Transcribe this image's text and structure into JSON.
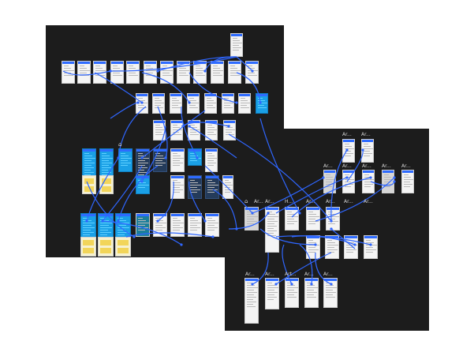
{
  "canvas": {
    "background": "#ffffff",
    "board_color": "#1c1c1c",
    "wire_color": "#2f66ff"
  },
  "right_board": {
    "artboard_labels": [
      "Ar...",
      "Ar...",
      "Ar...",
      "Ar...",
      "Ar...",
      "Ar...",
      "Ar...",
      "Ar...",
      "Ar...",
      "H...",
      "Ar...",
      "Ar...",
      "Ar...",
      "Ar...",
      "Art...",
      "Ar...",
      "Ar...",
      "Ar...",
      "Ar..."
    ],
    "home_icon": "home-icon"
  },
  "left_board": {
    "home_icon": "home-icon"
  }
}
